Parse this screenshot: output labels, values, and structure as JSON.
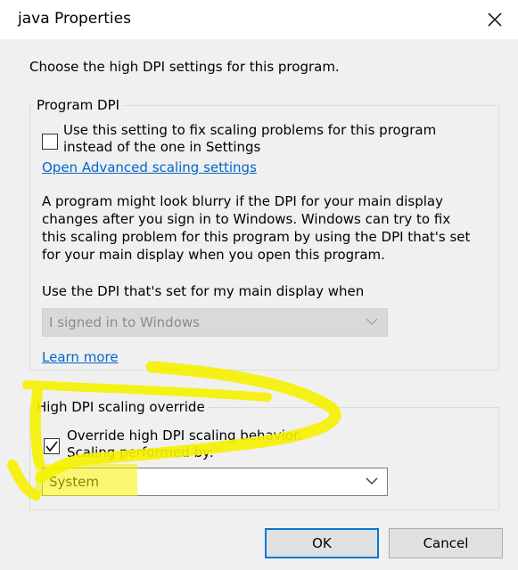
{
  "window": {
    "title": "java Properties",
    "close_symbol": "✕"
  },
  "intro_text": "Choose the high DPI settings for this program.",
  "program_dpi": {
    "legend": "Program DPI",
    "checkbox_line1": "Use this setting to fix scaling problems for this program",
    "checkbox_line2": "instead of the one in Settings",
    "checkbox_checked": false,
    "link_text": "Open Advanced scaling settings",
    "paragraph": [
      "A program might look blurry if the DPI for your main display",
      "changes after you sign in to Windows. Windows can try to fix",
      "this scaling problem for this program by using the DPI that's set",
      "for your main display when you open this program."
    ],
    "dropdown_label": "Use the DPI that's set for my main display when",
    "dropdown_value": "I signed in to Windows",
    "dropdown_enabled": false,
    "learn_more": "Learn more"
  },
  "override": {
    "legend": "High DPI scaling override",
    "checkbox_line1": "Override high DPI scaling behavior.",
    "checkbox_line2": "Scaling performed by:",
    "checkbox_checked": true,
    "dropdown_value": "System"
  },
  "buttons": {
    "ok": "OK",
    "cancel": "Cancel"
  },
  "colors": {
    "link": "#0066cc",
    "highlighter": "#f6f200",
    "dialog_bg": "#f0f0f0"
  }
}
